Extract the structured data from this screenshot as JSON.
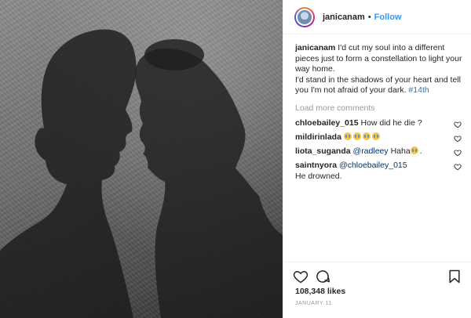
{
  "post": {
    "username": "janicanam",
    "separator": "•",
    "follow_label": "Follow"
  },
  "caption": {
    "username": "janicanam",
    "text_1": "I'd cut my soul into a different pieces just to form a constellation to light your way home.",
    "text_2": "I'd stand in the shadows of your heart and tell you I'm not afraid of your dark.",
    "hashtag": "#14th"
  },
  "load_more_label": "Load more comments",
  "comments": [
    {
      "username": "chloebailey_015",
      "text": "How did he die ?"
    },
    {
      "username": "mildirinlada",
      "emojis": [
        "crying-face",
        "crying-face",
        "crying-face",
        "crying-face"
      ]
    },
    {
      "username": "liota_suganda",
      "mention": "@radleey",
      "text": "Haha"
    },
    {
      "username": "saintnyora",
      "mention": "@chloebailey_015",
      "text": "He drowned."
    }
  ],
  "actions": {
    "icons": [
      "heart-icon",
      "comment-icon",
      "bookmark-icon"
    ]
  },
  "likes": "108,348 likes",
  "date": "JANUARY 11",
  "colors": {
    "link_blue": "#3897f0",
    "hashtag_blue": "#3f729b",
    "muted": "#999999",
    "text": "#262626"
  }
}
